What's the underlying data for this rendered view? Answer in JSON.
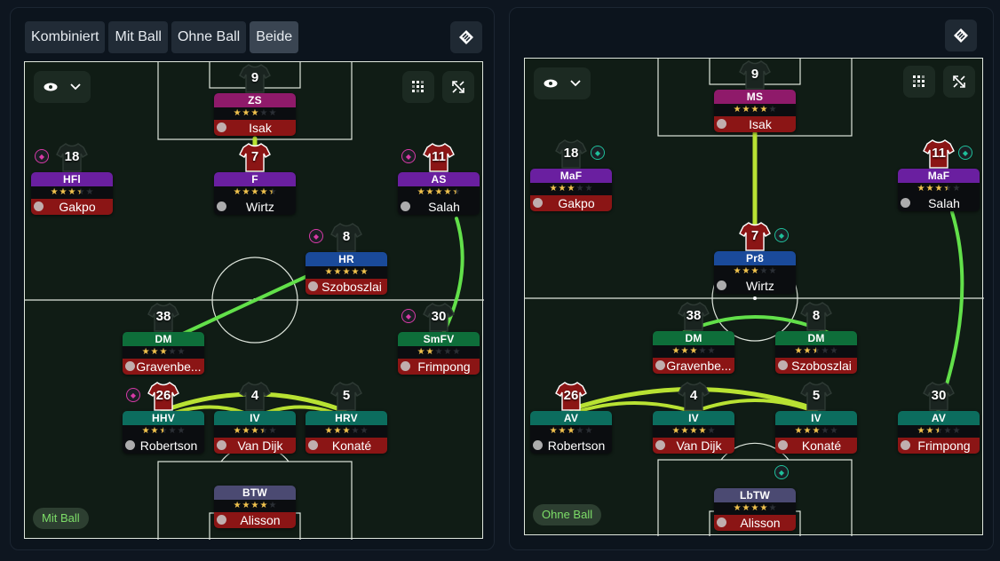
{
  "tabs": [
    "Kombiniert",
    "Mit Ball",
    "Ohne Ball",
    "Beide"
  ],
  "active_tab": "Beide",
  "colors": {
    "purple": "#6a1fa0",
    "magenta": "#8f1a6a",
    "blue": "#1a4a9a",
    "green": "#0e6e3a",
    "teal": "#0c6d5e",
    "slate": "#4b4a72",
    "red": "#8b1515",
    "dark": "#0b0d10",
    "link": "#b8e233",
    "linkGreen": "#62e04a",
    "star": "#f1c24d"
  },
  "left": {
    "badge": "Mit Ball",
    "players": [
      {
        "num": "9",
        "role": "ZS",
        "name": "Isak",
        "stars": 3.0,
        "role_color": "magenta",
        "name_color": "red",
        "shirt": "dark",
        "trait": ""
      },
      {
        "num": "18",
        "role": "HFl",
        "name": "Gakpo",
        "stars": 3.5,
        "role_color": "purple",
        "name_color": "red",
        "shirt": "dark",
        "trait": "pink"
      },
      {
        "num": "7",
        "role": "F",
        "name": "Wirtz",
        "stars": 4.5,
        "role_color": "purple",
        "name_color": "dark",
        "shirt": "red",
        "trait": ""
      },
      {
        "num": "11",
        "role": "AS",
        "name": "Salah",
        "stars": 4.5,
        "role_color": "purple",
        "name_color": "dark",
        "shirt": "red",
        "trait": "pink"
      },
      {
        "num": "8",
        "role": "HR",
        "name": "Szoboszlai",
        "stars": 5.0,
        "role_color": "blue",
        "name_color": "red",
        "shirt": "dark",
        "trait": "pink"
      },
      {
        "num": "38",
        "role": "DM",
        "name": "Gravenbe...",
        "stars": 3.0,
        "role_color": "green",
        "name_color": "red",
        "shirt": "dark",
        "trait": ""
      },
      {
        "num": "30",
        "role": "SmFV",
        "name": "Frimpong",
        "stars": 2.0,
        "role_color": "green",
        "name_color": "red",
        "shirt": "dark",
        "trait": "pink"
      },
      {
        "num": "26",
        "role": "HHV",
        "name": "Robertson",
        "stars": 2.5,
        "role_color": "teal",
        "name_color": "dark",
        "shirt": "red",
        "trait": "pink"
      },
      {
        "num": "4",
        "role": "IV",
        "name": "Van Dijk",
        "stars": 3.5,
        "role_color": "teal",
        "name_color": "red",
        "shirt": "dark",
        "trait": ""
      },
      {
        "num": "5",
        "role": "HRV",
        "name": "Konaté",
        "stars": 3.0,
        "role_color": "teal",
        "name_color": "red",
        "shirt": "dark",
        "trait": ""
      },
      {
        "num": "",
        "role": "BTW",
        "name": "Alisson",
        "stars": 4.0,
        "role_color": "slate",
        "name_color": "red",
        "shirt": "none",
        "trait": ""
      }
    ]
  },
  "right": {
    "badge": "Ohne Ball",
    "players": [
      {
        "num": "9",
        "role": "MS",
        "name": "Isak",
        "stars": 4.0,
        "role_color": "magenta",
        "name_color": "red",
        "shirt": "dark",
        "trait": ""
      },
      {
        "num": "18",
        "role": "MaF",
        "name": "Gakpo",
        "stars": 3.0,
        "role_color": "purple",
        "name_color": "red",
        "shirt": "dark",
        "trait": "teal"
      },
      {
        "num": "11",
        "role": "MaF",
        "name": "Salah",
        "stars": 3.5,
        "role_color": "purple",
        "name_color": "dark",
        "shirt": "red",
        "trait": "teal"
      },
      {
        "num": "7",
        "role": "Pr8",
        "name": "Wirtz",
        "stars": 3.0,
        "role_color": "blue",
        "name_color": "dark",
        "shirt": "red",
        "trait": "teal"
      },
      {
        "num": "38",
        "role": "DM",
        "name": "Gravenbe...",
        "stars": 3.0,
        "role_color": "green",
        "name_color": "red",
        "shirt": "dark",
        "trait": ""
      },
      {
        "num": "8",
        "role": "DM",
        "name": "Szoboszlai",
        "stars": 2.5,
        "role_color": "green",
        "name_color": "red",
        "shirt": "dark",
        "trait": ""
      },
      {
        "num": "26",
        "role": "AV",
        "name": "Robertson",
        "stars": 3.0,
        "role_color": "teal",
        "name_color": "dark",
        "shirt": "red",
        "trait": ""
      },
      {
        "num": "4",
        "role": "IV",
        "name": "Van Dijk",
        "stars": 4.0,
        "role_color": "teal",
        "name_color": "red",
        "shirt": "dark",
        "trait": ""
      },
      {
        "num": "5",
        "role": "IV",
        "name": "Konaté",
        "stars": 3.0,
        "role_color": "teal",
        "name_color": "red",
        "shirt": "dark",
        "trait": ""
      },
      {
        "num": "30",
        "role": "AV",
        "name": "Frimpong",
        "stars": 2.5,
        "role_color": "teal",
        "name_color": "red",
        "shirt": "dark",
        "trait": ""
      },
      {
        "num": "",
        "role": "LbTW",
        "name": "Alisson",
        "stars": 4.0,
        "role_color": "slate",
        "name_color": "red",
        "shirt": "none",
        "trait": "teal"
      }
    ]
  }
}
